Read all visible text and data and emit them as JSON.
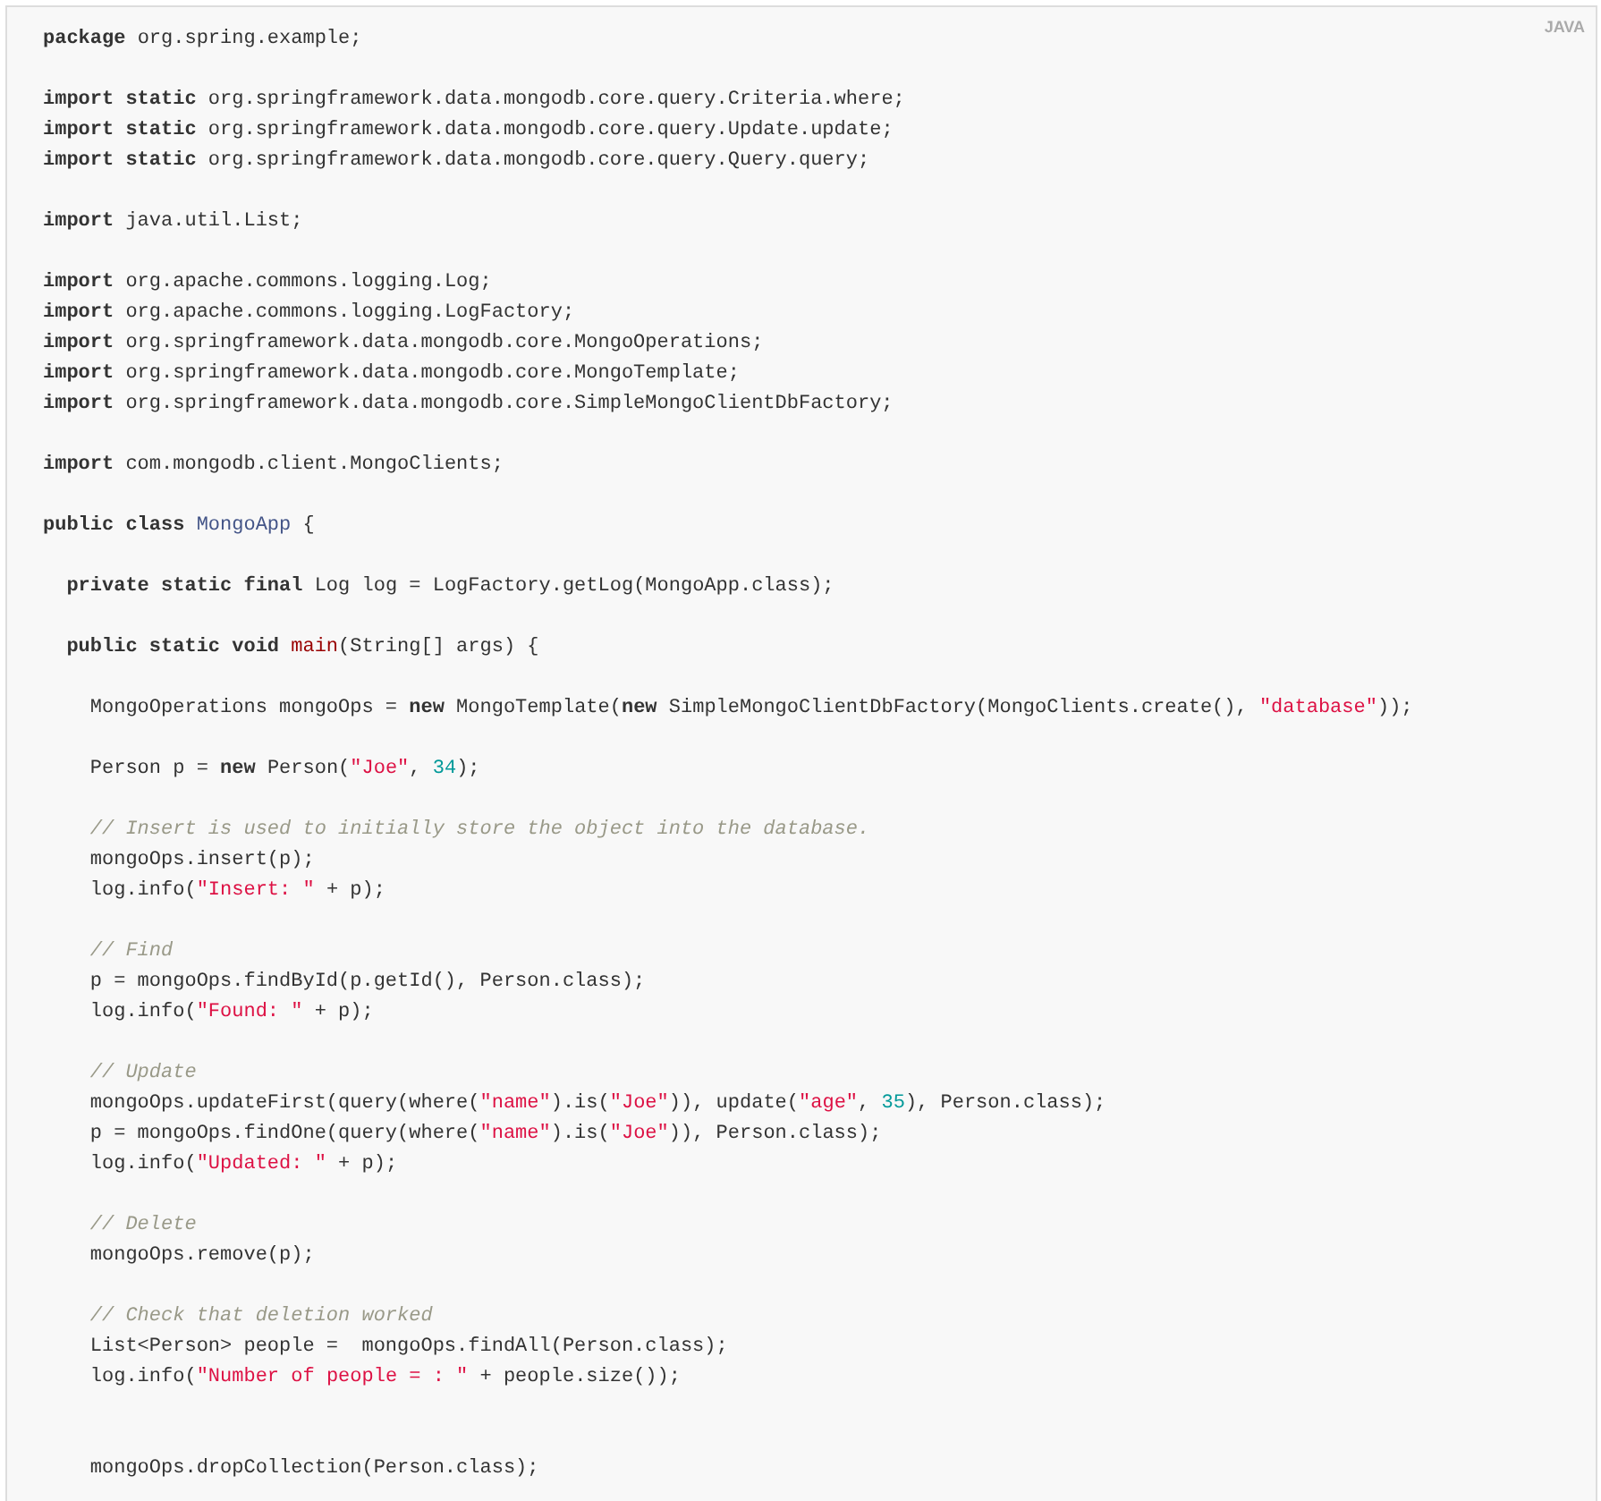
{
  "code_block": {
    "language_label": "JAVA",
    "lines": [
      {
        "kind": "code",
        "tokens": [
          {
            "kind": "keyword",
            "text": "package"
          },
          {
            "kind": "plain",
            "text": " org.spring.example;"
          }
        ]
      },
      {
        "kind": "blank"
      },
      {
        "kind": "code",
        "tokens": [
          {
            "kind": "keyword",
            "text": "import static"
          },
          {
            "kind": "plain",
            "text": " org.springframework.data.mongodb.core.query.Criteria.where;"
          }
        ]
      },
      {
        "kind": "code",
        "tokens": [
          {
            "kind": "keyword",
            "text": "import static"
          },
          {
            "kind": "plain",
            "text": " org.springframework.data.mongodb.core.query.Update.update;"
          }
        ]
      },
      {
        "kind": "code",
        "tokens": [
          {
            "kind": "keyword",
            "text": "import static"
          },
          {
            "kind": "plain",
            "text": " org.springframework.data.mongodb.core.query.Query.query;"
          }
        ]
      },
      {
        "kind": "blank"
      },
      {
        "kind": "code",
        "tokens": [
          {
            "kind": "keyword",
            "text": "import"
          },
          {
            "kind": "plain",
            "text": " java.util.List;"
          }
        ]
      },
      {
        "kind": "blank"
      },
      {
        "kind": "code",
        "tokens": [
          {
            "kind": "keyword",
            "text": "import"
          },
          {
            "kind": "plain",
            "text": " org.apache.commons.logging.Log;"
          }
        ]
      },
      {
        "kind": "code",
        "tokens": [
          {
            "kind": "keyword",
            "text": "import"
          },
          {
            "kind": "plain",
            "text": " org.apache.commons.logging.LogFactory;"
          }
        ]
      },
      {
        "kind": "code",
        "tokens": [
          {
            "kind": "keyword",
            "text": "import"
          },
          {
            "kind": "plain",
            "text": " org.springframework.data.mongodb.core.MongoOperations;"
          }
        ]
      },
      {
        "kind": "code",
        "tokens": [
          {
            "kind": "keyword",
            "text": "import"
          },
          {
            "kind": "plain",
            "text": " org.springframework.data.mongodb.core.MongoTemplate;"
          }
        ]
      },
      {
        "kind": "code",
        "tokens": [
          {
            "kind": "keyword",
            "text": "import"
          },
          {
            "kind": "plain",
            "text": " org.springframework.data.mongodb.core.SimpleMongoClientDbFactory;"
          }
        ]
      },
      {
        "kind": "blank"
      },
      {
        "kind": "code",
        "tokens": [
          {
            "kind": "keyword",
            "text": "import"
          },
          {
            "kind": "plain",
            "text": " com.mongodb.client.MongoClients;"
          }
        ]
      },
      {
        "kind": "blank"
      },
      {
        "kind": "code",
        "tokens": [
          {
            "kind": "keyword",
            "text": "public class "
          },
          {
            "kind": "type",
            "text": "MongoApp"
          },
          {
            "kind": "plain",
            "text": " {"
          }
        ]
      },
      {
        "kind": "blank"
      },
      {
        "kind": "code",
        "tokens": [
          {
            "kind": "keyword",
            "text": "  private static final"
          },
          {
            "kind": "plain",
            "text": " Log log = LogFactory.getLog(MongoApp.class);"
          }
        ]
      },
      {
        "kind": "blank"
      },
      {
        "kind": "code",
        "tokens": [
          {
            "kind": "keyword",
            "text": "  public static void "
          },
          {
            "kind": "function",
            "text": "main"
          },
          {
            "kind": "plain",
            "text": "(String[] args) {"
          }
        ]
      },
      {
        "kind": "blank"
      },
      {
        "kind": "code",
        "tokens": [
          {
            "kind": "plain",
            "text": "    MongoOperations mongoOps = "
          },
          {
            "kind": "keyword",
            "text": "new"
          },
          {
            "kind": "plain",
            "text": " MongoTemplate("
          },
          {
            "kind": "keyword",
            "text": "new"
          },
          {
            "kind": "plain",
            "text": " SimpleMongoClientDbFactory(MongoClients.create(), "
          },
          {
            "kind": "string",
            "text": "\"database\""
          },
          {
            "kind": "plain",
            "text": "));"
          }
        ]
      },
      {
        "kind": "blank"
      },
      {
        "kind": "code",
        "tokens": [
          {
            "kind": "plain",
            "text": "    Person p = "
          },
          {
            "kind": "keyword",
            "text": "new"
          },
          {
            "kind": "plain",
            "text": " Person("
          },
          {
            "kind": "string",
            "text": "\"Joe\""
          },
          {
            "kind": "plain",
            "text": ", "
          },
          {
            "kind": "number",
            "text": "34"
          },
          {
            "kind": "plain",
            "text": ");"
          }
        ]
      },
      {
        "kind": "blank"
      },
      {
        "kind": "code",
        "tokens": [
          {
            "kind": "comment",
            "text": "    // Insert is used to initially store the object into the database."
          }
        ]
      },
      {
        "kind": "code",
        "tokens": [
          {
            "kind": "plain",
            "text": "    mongoOps.insert(p);"
          }
        ]
      },
      {
        "kind": "code",
        "tokens": [
          {
            "kind": "plain",
            "text": "    log.info("
          },
          {
            "kind": "string",
            "text": "\"Insert: \""
          },
          {
            "kind": "plain",
            "text": " + p);"
          }
        ]
      },
      {
        "kind": "blank"
      },
      {
        "kind": "code",
        "tokens": [
          {
            "kind": "comment",
            "text": "    // Find"
          }
        ]
      },
      {
        "kind": "code",
        "tokens": [
          {
            "kind": "plain",
            "text": "    p = mongoOps.findById(p.getId(), Person.class);"
          }
        ]
      },
      {
        "kind": "code",
        "tokens": [
          {
            "kind": "plain",
            "text": "    log.info("
          },
          {
            "kind": "string",
            "text": "\"Found: \""
          },
          {
            "kind": "plain",
            "text": " + p);"
          }
        ]
      },
      {
        "kind": "blank"
      },
      {
        "kind": "code",
        "tokens": [
          {
            "kind": "comment",
            "text": "    // Update"
          }
        ]
      },
      {
        "kind": "code",
        "tokens": [
          {
            "kind": "plain",
            "text": "    mongoOps.updateFirst(query(where("
          },
          {
            "kind": "string",
            "text": "\"name\""
          },
          {
            "kind": "plain",
            "text": ").is("
          },
          {
            "kind": "string",
            "text": "\"Joe\""
          },
          {
            "kind": "plain",
            "text": ")), update("
          },
          {
            "kind": "string",
            "text": "\"age\""
          },
          {
            "kind": "plain",
            "text": ", "
          },
          {
            "kind": "number",
            "text": "35"
          },
          {
            "kind": "plain",
            "text": "), Person.class);"
          }
        ]
      },
      {
        "kind": "code",
        "tokens": [
          {
            "kind": "plain",
            "text": "    p = mongoOps.findOne(query(where("
          },
          {
            "kind": "string",
            "text": "\"name\""
          },
          {
            "kind": "plain",
            "text": ").is("
          },
          {
            "kind": "string",
            "text": "\"Joe\""
          },
          {
            "kind": "plain",
            "text": ")), Person.class);"
          }
        ]
      },
      {
        "kind": "code",
        "tokens": [
          {
            "kind": "plain",
            "text": "    log.info("
          },
          {
            "kind": "string",
            "text": "\"Updated: \""
          },
          {
            "kind": "plain",
            "text": " + p);"
          }
        ]
      },
      {
        "kind": "blank"
      },
      {
        "kind": "code",
        "tokens": [
          {
            "kind": "comment",
            "text": "    // Delete"
          }
        ]
      },
      {
        "kind": "code",
        "tokens": [
          {
            "kind": "plain",
            "text": "    mongoOps.remove(p);"
          }
        ]
      },
      {
        "kind": "blank"
      },
      {
        "kind": "code",
        "tokens": [
          {
            "kind": "comment",
            "text": "    // Check that deletion worked"
          }
        ]
      },
      {
        "kind": "code",
        "tokens": [
          {
            "kind": "plain",
            "text": "    List<Person> people =  mongoOps.findAll(Person.class);"
          }
        ]
      },
      {
        "kind": "code",
        "tokens": [
          {
            "kind": "plain",
            "text": "    log.info("
          },
          {
            "kind": "string",
            "text": "\"Number of people = : \""
          },
          {
            "kind": "plain",
            "text": " + people.size());"
          }
        ]
      },
      {
        "kind": "blank"
      },
      {
        "kind": "blank"
      },
      {
        "kind": "code",
        "tokens": [
          {
            "kind": "plain",
            "text": "    mongoOps.dropCollection(Person.class);"
          }
        ]
      }
    ]
  }
}
